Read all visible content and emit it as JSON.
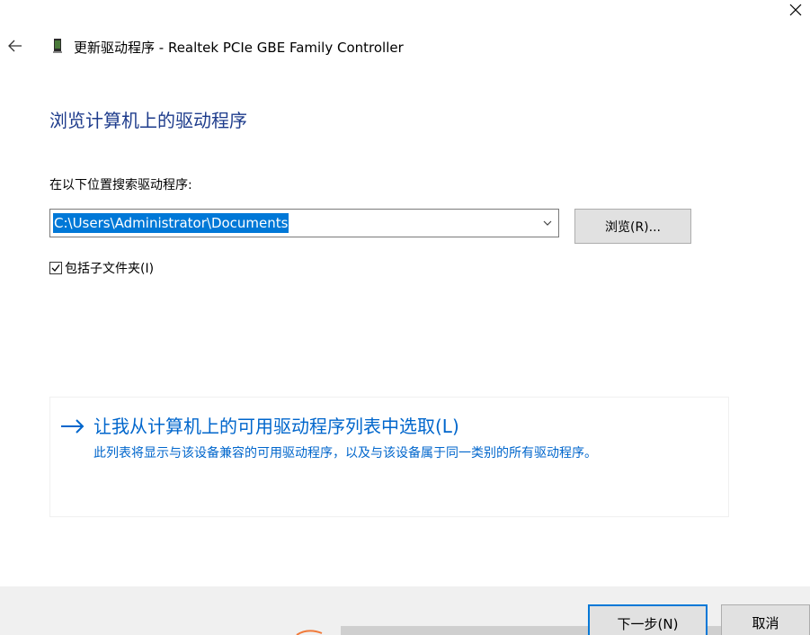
{
  "window": {
    "title": "更新驱动程序 - Realtek PCIe GBE Family Controller",
    "close_icon": "close-icon",
    "back_icon": "back-arrow-icon",
    "device_icon": "network-adapter-icon"
  },
  "page": {
    "heading": "浏览计算机上的驱动程序"
  },
  "search": {
    "label": "在以下位置搜索驱动程序:",
    "path_value": "C:\\Users\\Administrator\\Documents",
    "browse_label": "浏览(R)..."
  },
  "include_subfolders": {
    "label": "包括子文件夹(I)",
    "checked": true
  },
  "pick_option": {
    "title": "让我从计算机上的可用驱动程序列表中选取(L)",
    "description": "此列表将显示与该设备兼容的可用驱动程序，以及与该设备属于同一类别的所有驱动程序。"
  },
  "footer": {
    "next_label": "下一步(N)",
    "cancel_label": "取消"
  },
  "colors": {
    "heading": "#1e3c8c",
    "link": "#0066cc",
    "selection": "#0078d7",
    "footer_bg": "#f0f0f0"
  }
}
